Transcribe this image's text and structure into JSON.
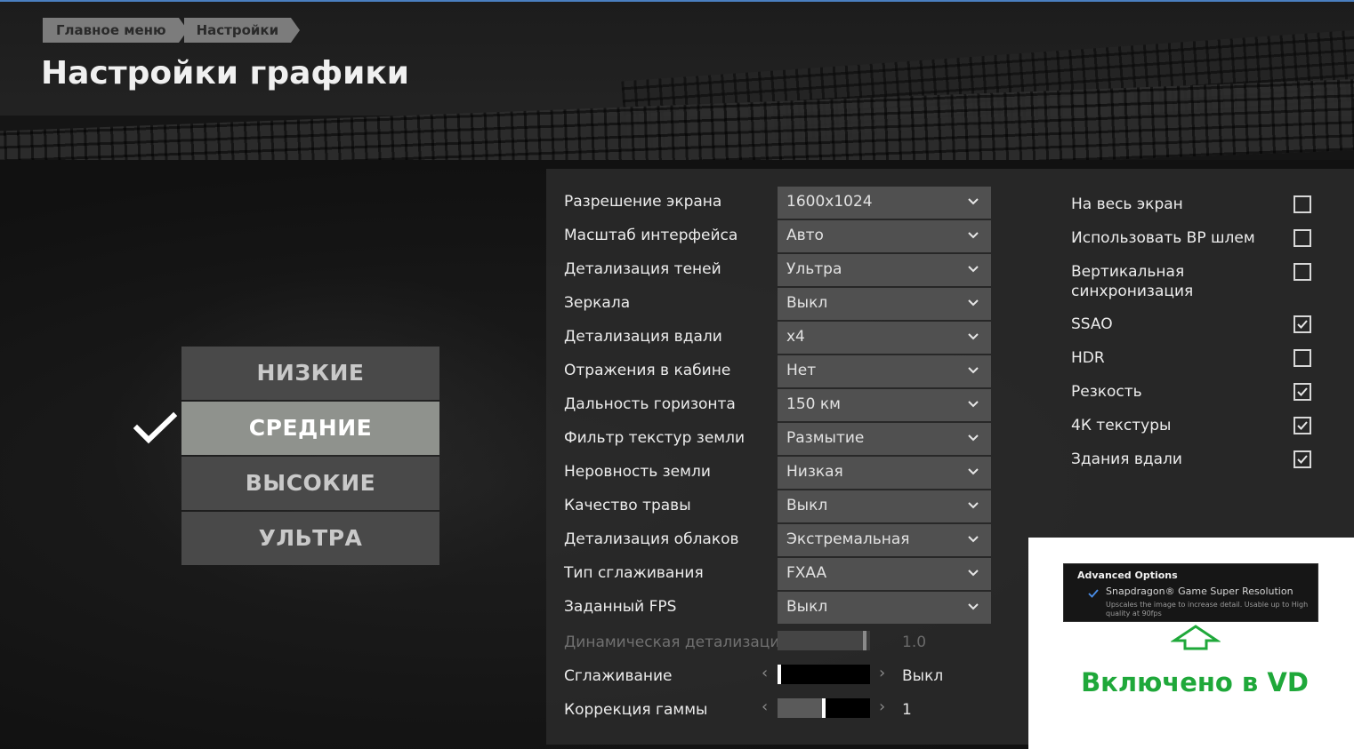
{
  "breadcrumb": {
    "items": [
      "Главное меню",
      "Настройки"
    ]
  },
  "page_title": "Настройки графики",
  "presets": {
    "items": [
      "НИЗКИЕ",
      "СРЕДНИЕ",
      "ВЫСОКИЕ",
      "УЛЬТРА"
    ],
    "selected": "СРЕДНИЕ"
  },
  "settings": [
    {
      "label": "Разрешение экрана",
      "value": "1600x1024"
    },
    {
      "label": "Масштаб интерфейса",
      "value": "Авто"
    },
    {
      "label": "Детализация теней",
      "value": "Ультра"
    },
    {
      "label": "Зеркала",
      "value": "Выкл"
    },
    {
      "label": "Детализация вдали",
      "value": "x4"
    },
    {
      "label": "Отражения в кабине",
      "value": "Нет"
    },
    {
      "label": "Дальность горизонта",
      "value": "150 км"
    },
    {
      "label": "Фильтр текстур земли",
      "value": "Размытие"
    },
    {
      "label": "Неровность земли",
      "value": "Низкая"
    },
    {
      "label": "Качество травы",
      "value": "Выкл"
    },
    {
      "label": "Детализация облаков",
      "value": "Экстремальная"
    },
    {
      "label": "Тип сглаживания",
      "value": "FXAA"
    },
    {
      "label": "Заданный FPS",
      "value": "Выкл"
    }
  ],
  "sliders": {
    "dynamic_detail": {
      "label": "Динамическая детализация",
      "value": "1.0",
      "level": 0.96,
      "disabled": true
    },
    "antialiasing": {
      "label": "Сглаживание",
      "value": "Выкл",
      "level": 0.0
    },
    "gamma": {
      "label": "Коррекция гаммы",
      "value": "1",
      "level": 0.5
    }
  },
  "toggles": [
    {
      "label": "На весь экран",
      "checked": false
    },
    {
      "label": "Использовать ВР шлем",
      "checked": false
    },
    {
      "label": "Вертикальная синхронизация",
      "checked": false
    },
    {
      "label": "SSAO",
      "checked": true
    },
    {
      "label": "HDR",
      "checked": false
    },
    {
      "label": "Резкость",
      "checked": true
    },
    {
      "label": "4К текстуры",
      "checked": true
    },
    {
      "label": "Здания вдали",
      "checked": true
    }
  ],
  "advanced_options": {
    "title": "Advanced Options",
    "option": "Snapdragon® Game Super Resolution",
    "description": "Upscales the image to increase detail. Usable up to High quality at 90fps",
    "checked": true,
    "caption": "Включено в VD"
  },
  "colors": {
    "accent_green": "#1fa83a",
    "preset_active": "#8f928d",
    "preset": "#494949"
  }
}
